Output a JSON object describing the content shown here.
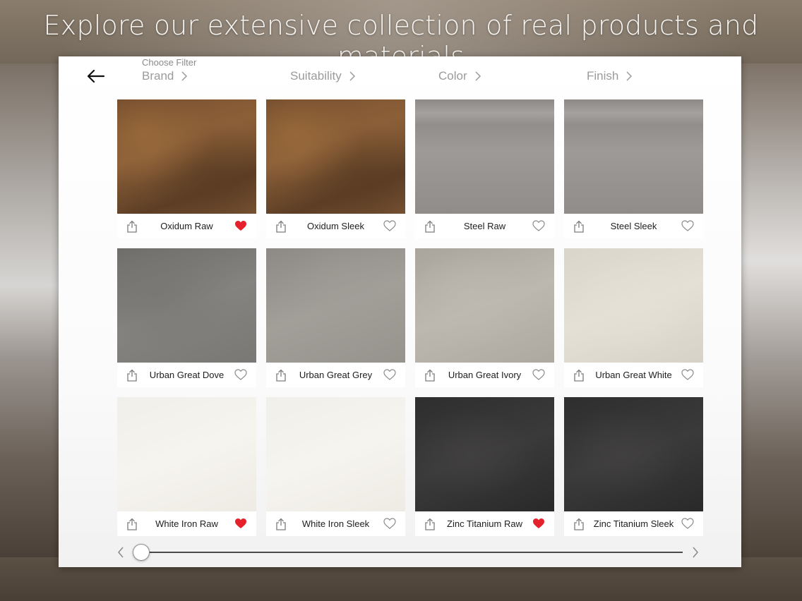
{
  "headline": "Explore our extensive collection of real products and materials",
  "filters": {
    "caption": "Choose Filter",
    "items": [
      {
        "label": "Brand"
      },
      {
        "label": "Suitability"
      },
      {
        "label": "Color"
      },
      {
        "label": "Finish"
      }
    ]
  },
  "products": [
    {
      "name": "Oxidum Raw",
      "favorited": true,
      "texture": "oxidum"
    },
    {
      "name": "Oxidum Sleek",
      "favorited": false,
      "texture": "oxidum"
    },
    {
      "name": "Steel Raw",
      "favorited": false,
      "texture": "steel"
    },
    {
      "name": "Steel Sleek",
      "favorited": false,
      "texture": "steel"
    },
    {
      "name": "Urban Great Dove",
      "favorited": false,
      "texture": "dove"
    },
    {
      "name": "Urban Great Grey",
      "favorited": false,
      "texture": "grey"
    },
    {
      "name": "Urban Great Ivory",
      "favorited": false,
      "texture": "ivory"
    },
    {
      "name": "Urban Great White",
      "favorited": false,
      "texture": "white"
    },
    {
      "name": "White Iron Raw",
      "favorited": true,
      "texture": "whiteiron"
    },
    {
      "name": "White Iron Sleek",
      "favorited": false,
      "texture": "whiteiron"
    },
    {
      "name": "Zinc Titanium Raw",
      "favorited": true,
      "texture": "zinc"
    },
    {
      "name": "Zinc Titanium Sleek",
      "favorited": false,
      "texture": "zinc"
    }
  ],
  "slider": {
    "position": 0.0
  },
  "colors": {
    "heart_active": "#e5222b",
    "text": "#1d1d1d",
    "filter_text": "#9b9b9b"
  },
  "icons": [
    "back-arrow-icon",
    "chevron-right-icon",
    "share-icon",
    "heart-icon",
    "chevron-left-icon"
  ]
}
